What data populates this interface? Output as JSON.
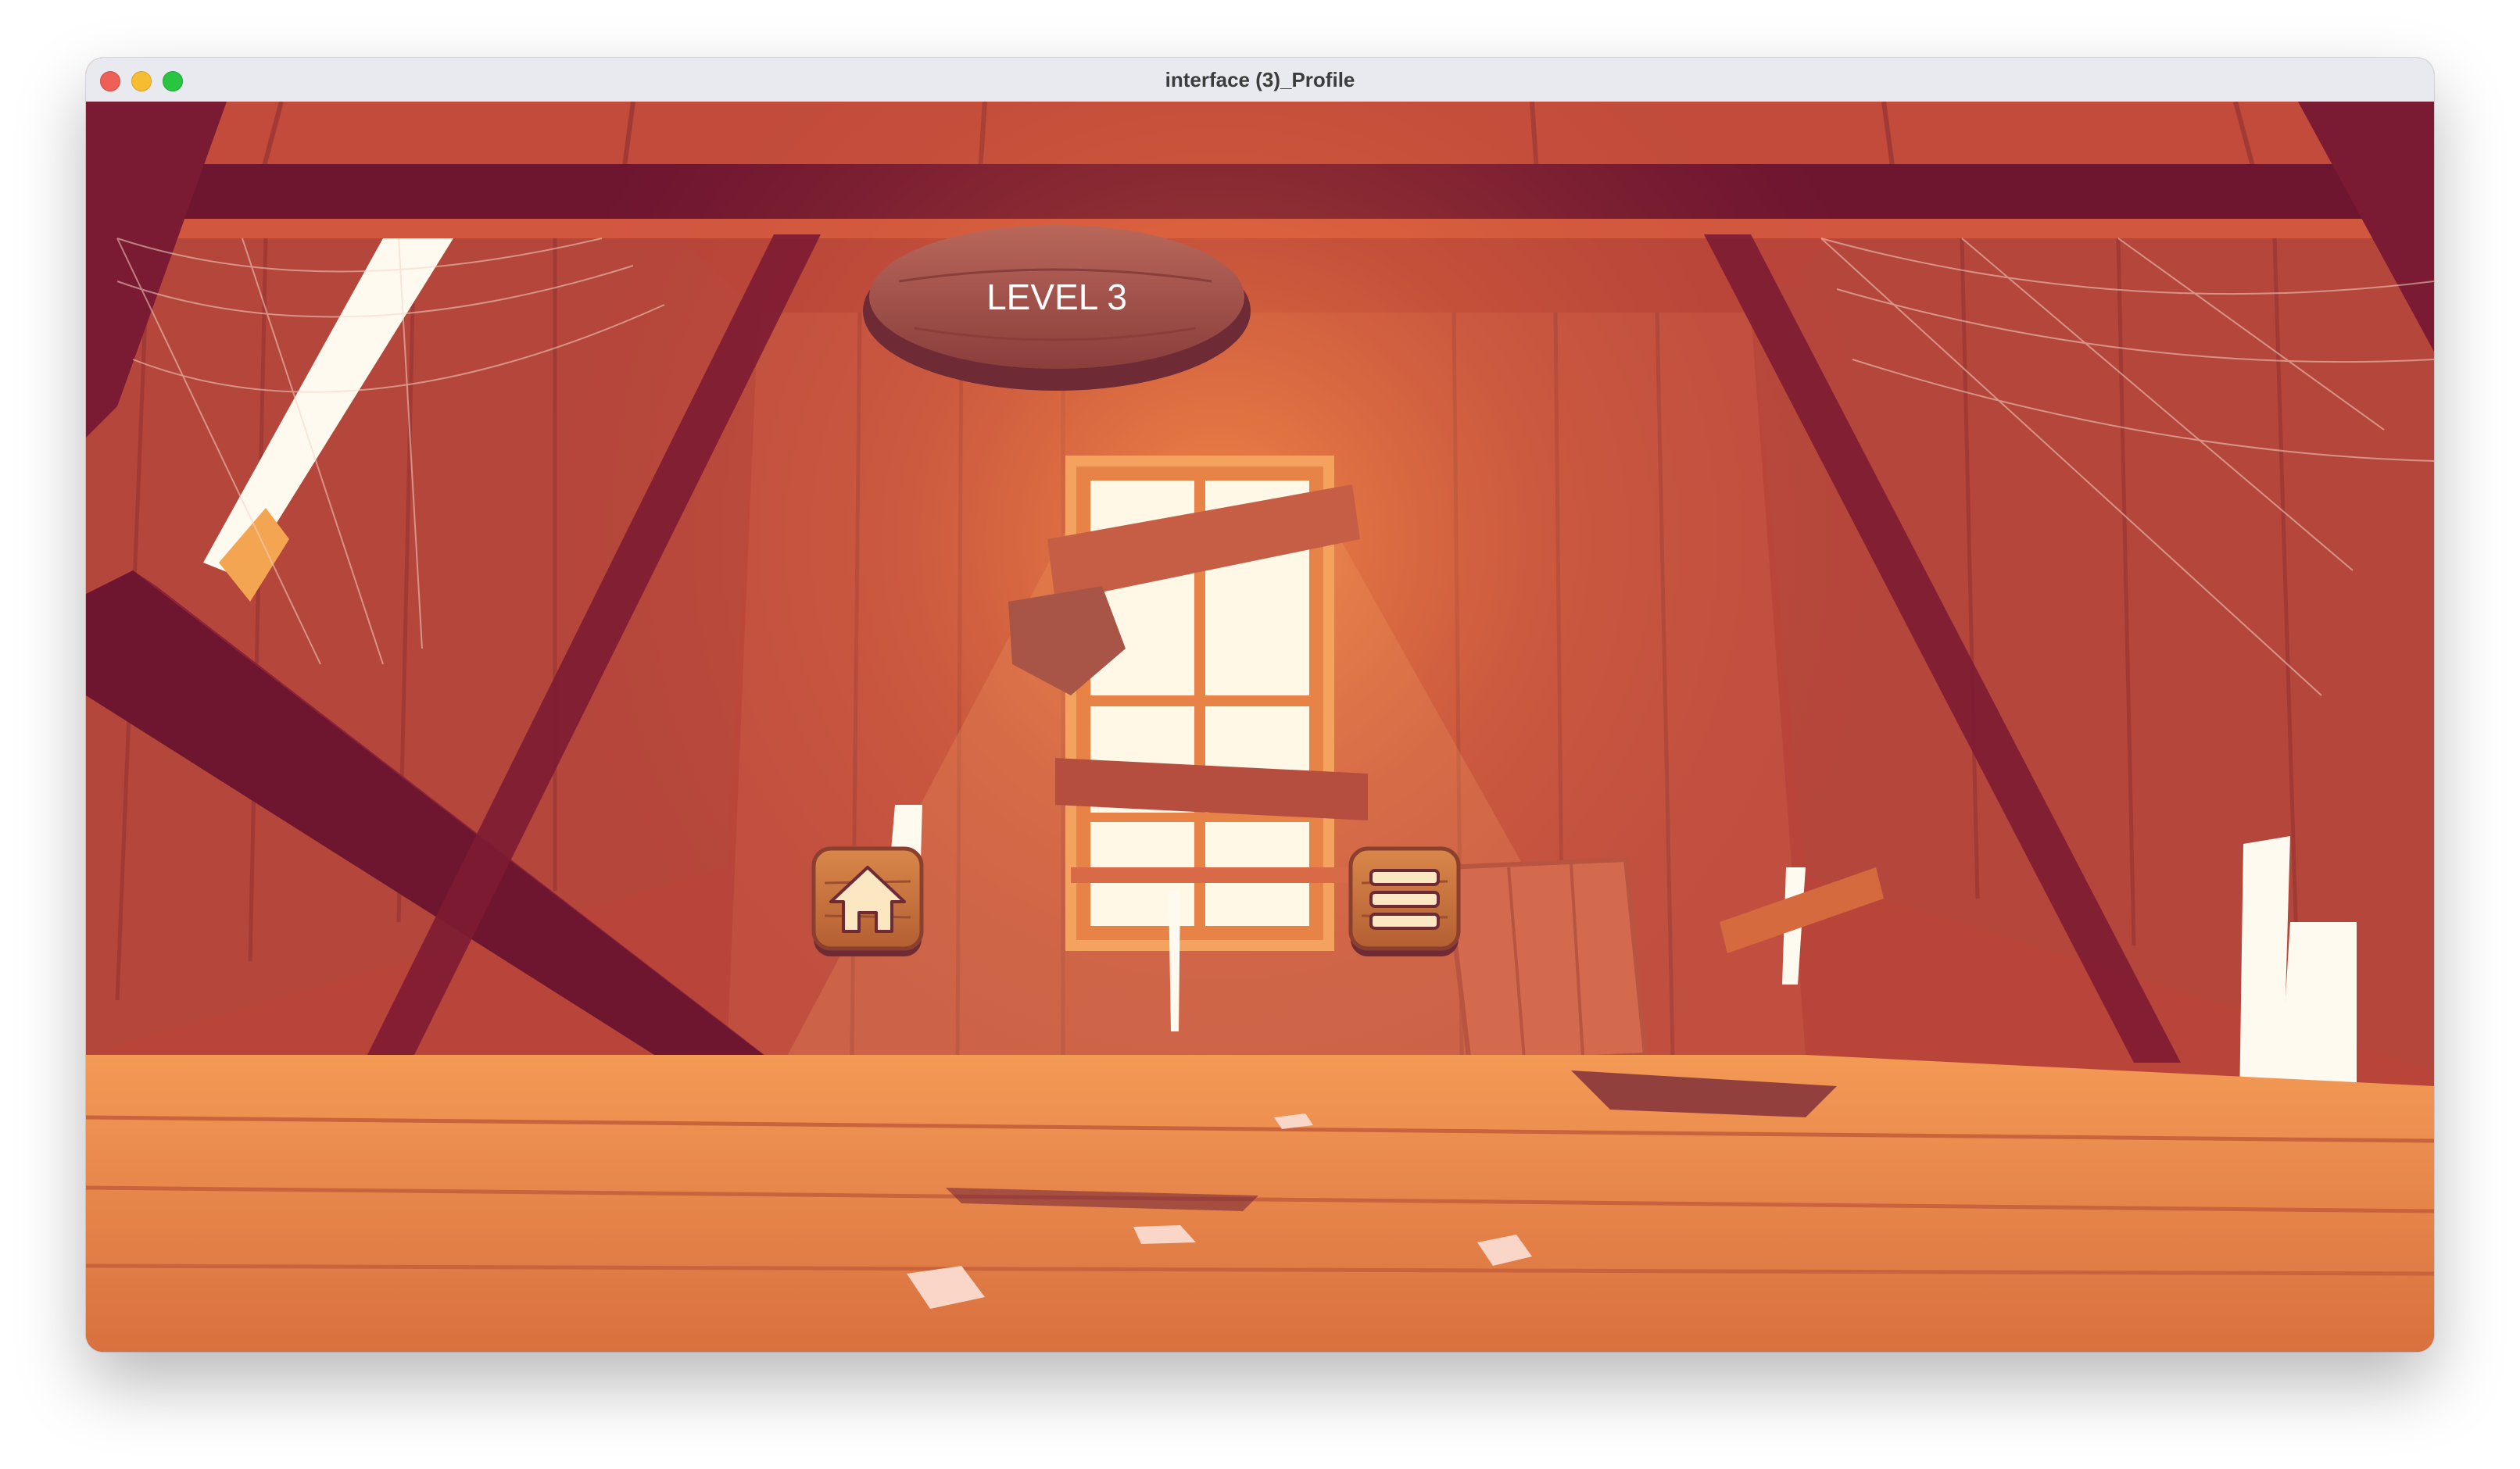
{
  "window": {
    "title": "interface (3)_Profile"
  },
  "game": {
    "level_label": "LEVEL 3",
    "buttons": [
      {
        "name": "home",
        "icon": "home-icon"
      },
      {
        "name": "menu",
        "icon": "menu-icon"
      }
    ]
  },
  "colors": {
    "wall": "#b8443a",
    "floor": "#e98a4e",
    "beam": "#6e1530",
    "sign_wood": "#9d4e43",
    "button_wood": "#c9763f",
    "icon_cream": "#fbe8c2",
    "window_light": "#fff8e7"
  }
}
